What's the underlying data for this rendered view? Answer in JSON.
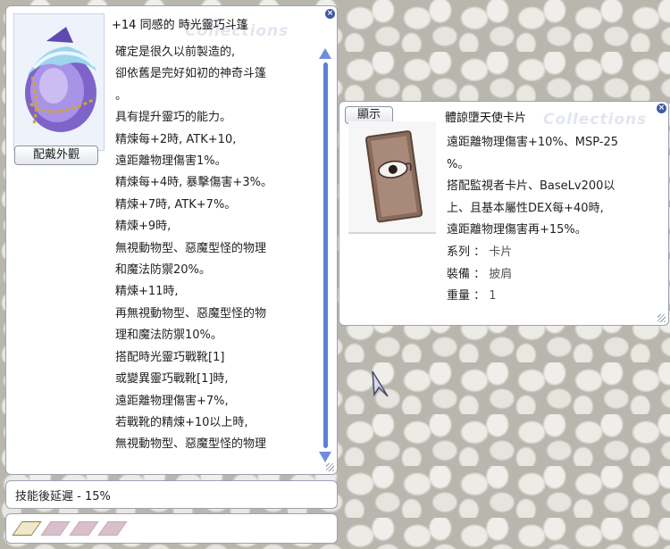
{
  "item": {
    "title": "+14 同感的 時光靈巧斗篷",
    "watermark": "Collections",
    "appearance_button": "配戴外觀",
    "description": [
      "確定是很久以前製造的,",
      "卻依舊是完好如初的神奇斗篷",
      "。",
      "具有提升靈巧的能力。",
      "精煉每+2時, ATK+10,",
      "遠距離物理傷害1%。",
      "精煉每+4時, 暴擊傷害+3%。",
      "精煉+7時, ATK+7%。",
      "精煉+9時,",
      "無視動物型、惡魔型怪的物理",
      "和魔法防禦20%。",
      "精煉+11時,",
      "再無視動物型、惡魔型怪的物",
      "理和魔法防禦10%。",
      "搭配時光靈巧戰靴[1]",
      "或變異靈巧戰靴[1]時,",
      "遠距離物理傷害+7%,",
      "若戰靴的精煉+10以上時,",
      "無視動物型、惡魔型怪的物理"
    ]
  },
  "card": {
    "title": "體諒墮天使卡片",
    "watermark": "Collections",
    "show_button": "顯示",
    "description": [
      "遠距離物理傷害+10%、MSP-25",
      "%。",
      "搭配監視者卡片、BaseLv200以",
      "上、且基本屬性DEX每+40時,",
      "遠距離物理傷害再+15%。"
    ],
    "properties": [
      {
        "label": "系列",
        "value": "卡片"
      },
      {
        "label": "裝備",
        "value": "披肩"
      },
      {
        "label": "重量",
        "value": "1"
      }
    ]
  },
  "extra_effect": "技能後延遲 - 15%",
  "slots": {
    "total": 4,
    "filled": 1
  },
  "colors": {
    "accent": "#3e5aa8",
    "scrollbar": "#5d7fd6",
    "border": "#9aa3b5",
    "empty_slot": "#d9bfc9"
  }
}
